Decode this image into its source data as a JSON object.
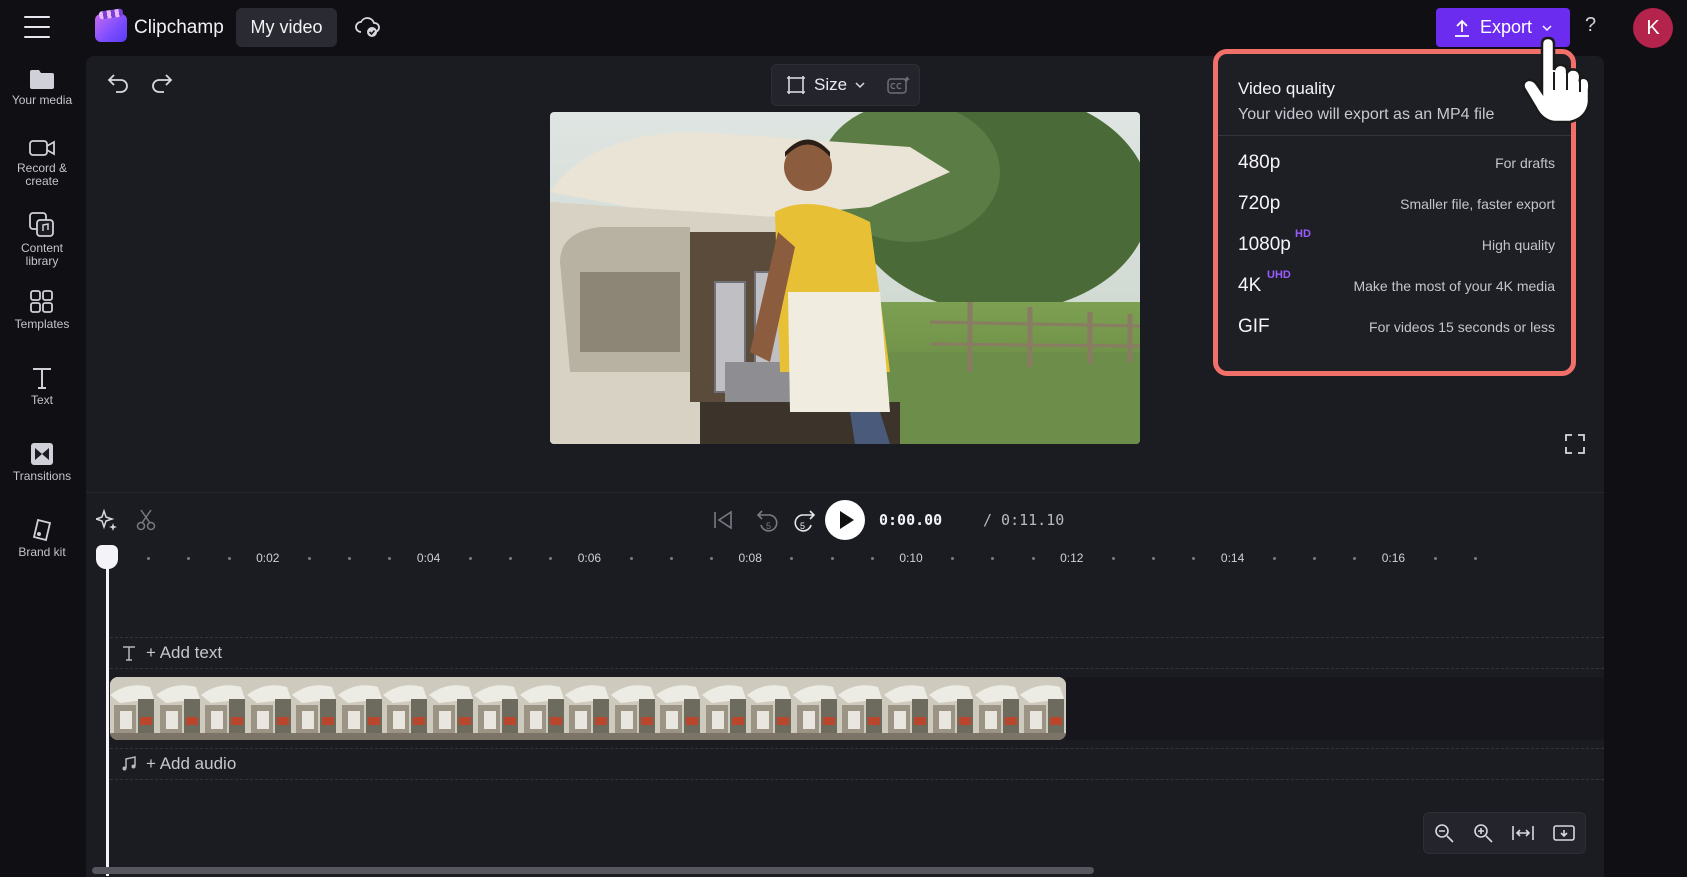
{
  "app": {
    "title": "Clipchamp",
    "project_name": "My video"
  },
  "topbar": {
    "export_label": "Export",
    "help": "?",
    "avatar_initial": "K"
  },
  "sidebar": {
    "items": [
      {
        "label_1": "Your media",
        "label_2": "",
        "icon": "folder-icon"
      },
      {
        "label_1": "Record &",
        "label_2": "create",
        "icon": "camera-icon"
      },
      {
        "label_1": "Content",
        "label_2": "library",
        "icon": "content-library-icon"
      },
      {
        "label_1": "Templates",
        "label_2": "",
        "icon": "templates-icon"
      },
      {
        "label_1": "Text",
        "label_2": "",
        "icon": "text-icon"
      },
      {
        "label_1": "Transitions",
        "label_2": "",
        "icon": "transitions-icon"
      },
      {
        "label_1": "Brand kit",
        "label_2": "",
        "icon": "brand-kit-icon"
      }
    ]
  },
  "preview": {
    "size_label": "Size"
  },
  "playback": {
    "current_time": "0:00.00",
    "total_time": "/ 0:11.10",
    "skip_seconds": "5"
  },
  "ruler": {
    "labels": [
      "0:02",
      "0:04",
      "0:06",
      "0:08",
      "0:10",
      "0:12",
      "0:14",
      "0:16"
    ]
  },
  "tracks": {
    "add_text": "+ Add text",
    "add_audio": "+ Add audio"
  },
  "export_menu": {
    "title": "Video quality",
    "subtitle": "Your video will export as an MP4 file",
    "options": [
      {
        "resolution": "480p",
        "badge": "",
        "description": "For drafts"
      },
      {
        "resolution": "720p",
        "badge": "",
        "description": "Smaller file, faster export"
      },
      {
        "resolution": "1080p",
        "badge": "HD",
        "description": "High quality"
      },
      {
        "resolution": "4K",
        "badge": "UHD",
        "description": "Make the most of your 4K media"
      },
      {
        "resolution": "GIF",
        "badge": "",
        "description": "For videos 15 seconds or less"
      }
    ]
  },
  "colors": {
    "accent": "#6b2cf0",
    "highlight": "#f2706a",
    "badge": "#9a5cff",
    "avatar": "#b4234b"
  }
}
